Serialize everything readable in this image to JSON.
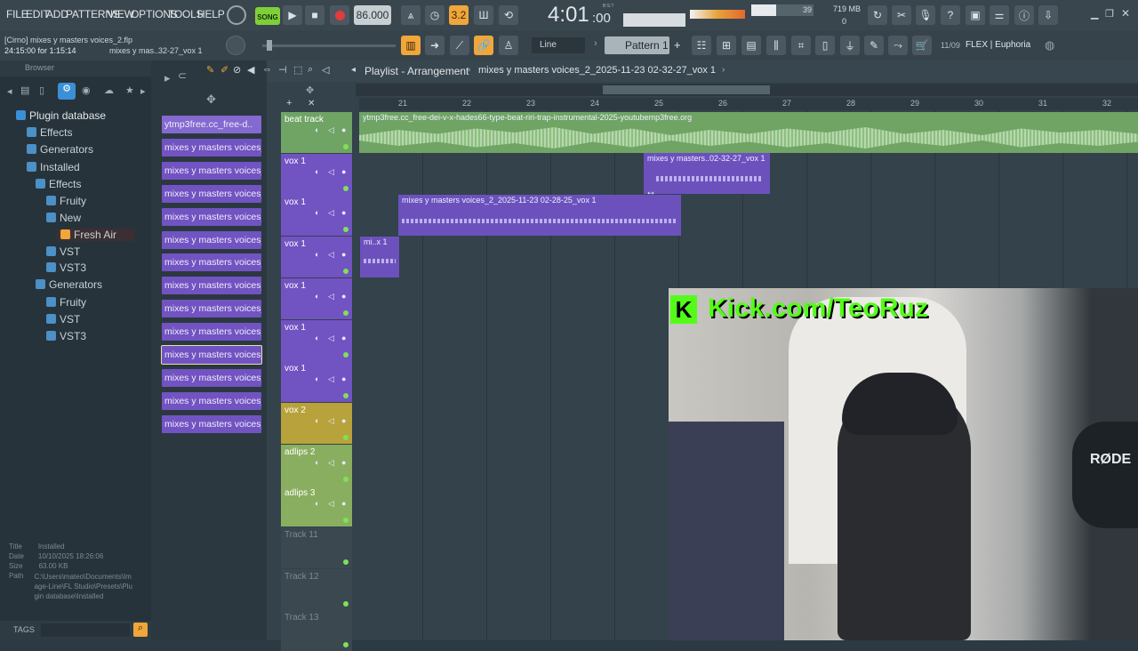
{
  "menu": [
    "FILE",
    "EDIT",
    "ADD",
    "PATTERNS",
    "VIEW",
    "OPTIONS",
    "TOOLS",
    "HELP"
  ],
  "transport": {
    "song_label": "SONG",
    "tempo": "86.000",
    "time": "4:01",
    "time_sub": ":00",
    "time_unit": "B:S:T",
    "cpu_value": "39",
    "mem": "719 MB",
    "poly": "0"
  },
  "project": {
    "file_line": "[Cirno] mixes y masters voices_2.flp",
    "time_line": "24:15:00 for 1:15:14",
    "clip_line": "mixes y mas..32-27_vox 1"
  },
  "row2": {
    "snap": "Line",
    "pattern": "Pattern 1",
    "counter": "11/09",
    "plugin_news": "FLEX | Euphoria"
  },
  "browser": {
    "title": "Browser",
    "root": "Plugin database",
    "items": [
      {
        "label": "Effects",
        "level": 1
      },
      {
        "label": "Generators",
        "level": 1
      },
      {
        "label": "Installed",
        "level": 1
      },
      {
        "label": "Effects",
        "level": 2
      },
      {
        "label": "Fruity",
        "level": 3
      },
      {
        "label": "New",
        "level": 3
      },
      {
        "label": "Fresh Air",
        "level": 4
      },
      {
        "label": "VST",
        "level": 3
      },
      {
        "label": "VST3",
        "level": 3
      },
      {
        "label": "Generators",
        "level": 2
      },
      {
        "label": "Fruity",
        "level": 3
      },
      {
        "label": "VST",
        "level": 3
      },
      {
        "label": "VST3",
        "level": 3
      }
    ],
    "info": {
      "title_k": "Title",
      "title_v": "Installed",
      "date_k": "Date",
      "date_v": "10/10/2025 18:26:06",
      "size_k": "Size",
      "size_v": "63.00 KB",
      "path_k": "Path",
      "path_v": "C:\\Users\\mateo\\Documents\\Image-Line\\FL Studio\\Presets\\Plugin database\\Installed"
    },
    "tags": "TAGS"
  },
  "channels": [
    "ytmp3free.cc_free-d..",
    "mixes y masters voices_2..",
    "mixes y masters voices_2..",
    "mixes y masters voices_2..",
    "mixes y masters voices_2..",
    "mixes y masters voices_2..",
    "mixes y masters voices_2..",
    "mixes y masters voices_2..",
    "mixes y masters voices_2..",
    "mixes y masters voices_2..",
    "mixes y masters voices_2..",
    "mixes y masters voices_2..",
    "mixes y masters voices_2..",
    "mixes y masters voices_2.."
  ],
  "playlist": {
    "title": "Playlist - Arrangement",
    "crumb": "mixes y masters voices_2_2025-11-23 02-32-27_vox 1",
    "bars": [
      "21",
      "22",
      "23",
      "24",
      "25",
      "26",
      "27",
      "28",
      "29",
      "30",
      "31",
      "32"
    ],
    "tracks": [
      "beat track",
      "vox 1",
      "vox 1",
      "vox 1",
      "vox 1",
      "vox 1",
      "vox 1",
      "vox 2",
      "adlips 2",
      "adlips 3",
      "Track 11",
      "Track 12",
      "Track 13"
    ],
    "clips": {
      "beat": "ytmp3free.cc_free-dei-v-x-hades66-type-beat-riri-trap-instrumental-2025-youtubemp3free.org",
      "c1": "mixes y masters..02-32-27_vox 1",
      "c2": "mixes y masters voices_2_2025-11-23 02-28-25_vox 1",
      "c3": "mi..x 1"
    }
  },
  "stream": {
    "overlay": "Kick.com/TeoRuz",
    "logo": "K",
    "mic_brand": "RØDE"
  },
  "colors": {
    "accent": "#f0a63a",
    "vox": "#7153c2",
    "beat": "#6fa464",
    "vox2": "#b8a23c",
    "adlips": "#8aae5f",
    "kick": "#53fc18"
  }
}
